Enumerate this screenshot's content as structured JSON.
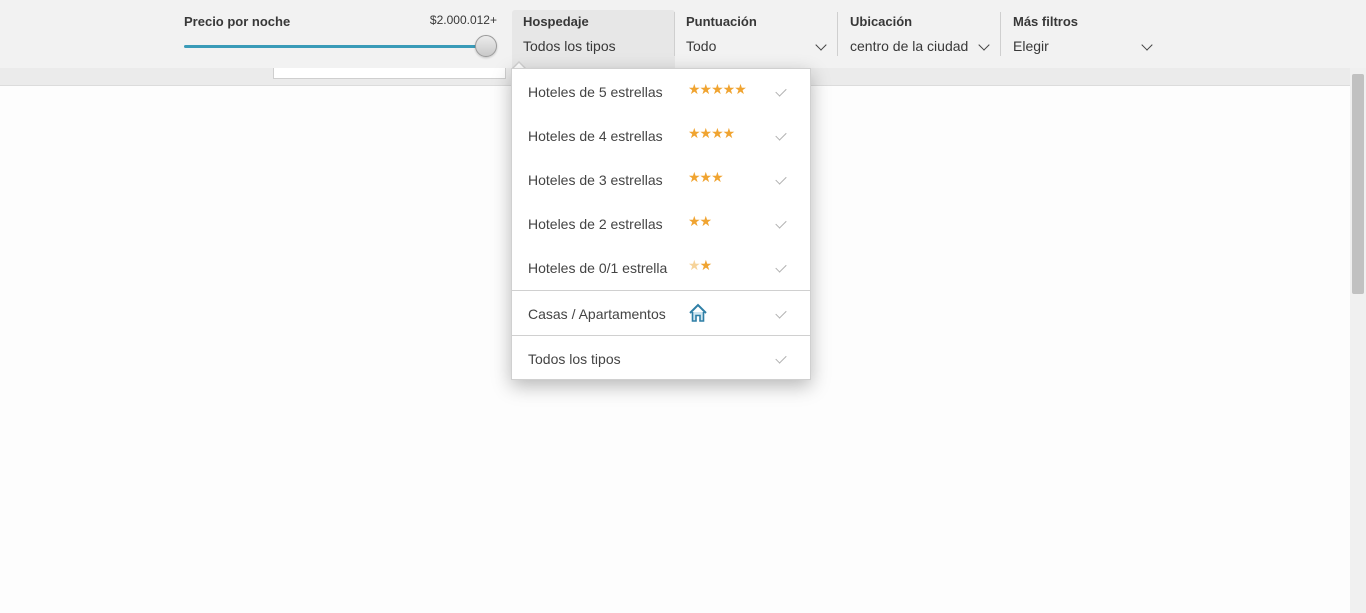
{
  "filters": {
    "price": {
      "label": "Precio por noche",
      "amount": "$2.000.012+",
      "slider_fraction": 1.0
    },
    "hospedaje": {
      "label": "Hospedaje",
      "value": "Todos los tipos"
    },
    "puntuacion": {
      "label": "Puntuación",
      "value": "Todo"
    },
    "ubicacion": {
      "label": "Ubicación",
      "value": "centro de la ciudad"
    },
    "mas_filtros": {
      "label": "Más filtros",
      "value": "Elegir"
    }
  },
  "dropdown": {
    "options": [
      {
        "label": "Hoteles de 5 estrellas",
        "stars": "★★★★★",
        "icon": "star-icon"
      },
      {
        "label": "Hoteles de 4 estrellas",
        "stars": "★★★★",
        "icon": "star-icon"
      },
      {
        "label": "Hoteles de 3 estrellas",
        "stars": "★★★",
        "icon": "star-icon"
      },
      {
        "label": "Hoteles de 2 estrellas",
        "stars": "★★",
        "icon": "star-icon"
      },
      {
        "label": "Hoteles de 0/1 estrella",
        "stars": "★",
        "icon": "star-icon"
      },
      {
        "label": "Casas / Apartamentos",
        "icon": "house-icon"
      },
      {
        "label": "Todos los tipos"
      }
    ]
  },
  "colors": {
    "accent": "#3a9bb8",
    "star": "#f0a431",
    "house": "#2f7fa6"
  }
}
